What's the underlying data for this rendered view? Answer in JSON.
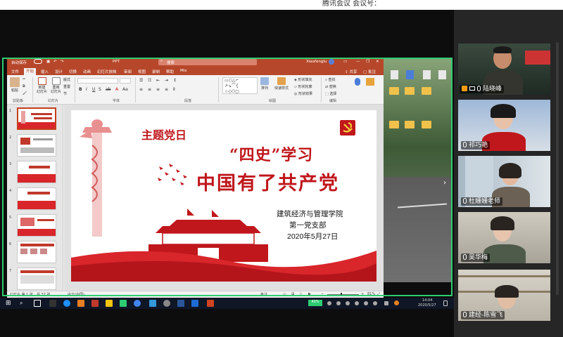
{
  "meeting": {
    "top_text": "腾讯会议 会议号："
  },
  "ppt": {
    "autosave_label": "自动保存",
    "title": "PPT",
    "search_placeholder": "搜索",
    "user": "Xiaofenglu",
    "tabs": [
      "文件",
      "开始",
      "插入",
      "设计",
      "切换",
      "动画",
      "幻灯片放映",
      "审阅",
      "视图",
      "录制",
      "帮助",
      "Mix"
    ],
    "active_tab": "开始",
    "share": "共享",
    "comment": "批注",
    "ribbon": {
      "paste": "粘贴",
      "new_slide": "新建\n幻灯片",
      "reuse": "重用\n幻灯片",
      "group_clipboard": "剪贴板",
      "group_slides": "幻灯片",
      "group_font": "字体",
      "group_paragraph": "段落",
      "group_drawing": "绘图",
      "group_editing": "编辑",
      "arrange": "排列",
      "quick_styles": "快速样式",
      "shape_fill": "形状填充",
      "shape_outline": "形状轮廓",
      "shape_effects": "形状效果",
      "find": "查找",
      "replace": "替换",
      "select": "选择",
      "layout": "版式",
      "reset": "重置",
      "section": "节"
    },
    "thumbnail_numbers": [
      "1",
      "2",
      "3",
      "4",
      "5",
      "6",
      "7"
    ],
    "slide": {
      "title_small": "主题党日",
      "title_mid": "“四史”学习",
      "title_big": "中国有了共产党",
      "org": "建筑经济与管理学院",
      "branch": "第一党支部",
      "date": "2020年5月27日"
    },
    "status": {
      "slide_count": "幻灯片 第 1 张，共 37 张",
      "language": "中文(中国)",
      "notes": "备注",
      "zoom": "81%"
    }
  },
  "taskbar": {
    "time": "14:04",
    "date": "2020/5/27",
    "tray_badge": "40%"
  },
  "participants": [
    {
      "name": "陆晓峰"
    },
    {
      "name": "祁巧艳"
    },
    {
      "name": "杜姗姗老师"
    },
    {
      "name": "吴华梅"
    },
    {
      "name": "建经-陈雪飞"
    }
  ],
  "colors": {
    "ppt_accent": "#b7472a",
    "slide_red": "#c0171c",
    "share_border": "#2ecc71"
  }
}
